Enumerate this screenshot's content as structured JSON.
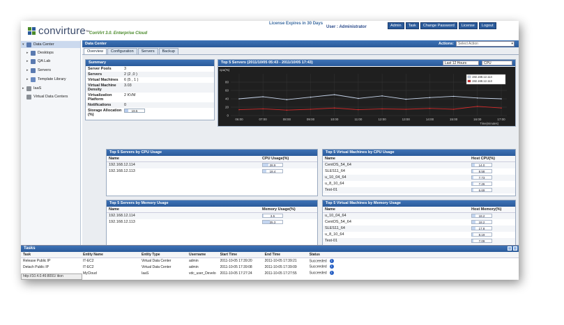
{
  "brand": {
    "name": "convirture",
    "tm": "TM",
    "edition": "ConVirt 3.0. Enterprise Cloud"
  },
  "header": {
    "license_text": "License Expires in 30 Days",
    "user_text": "User : Administrator",
    "nav": [
      "Admin",
      "Task",
      "Change Password",
      "License",
      "Logout"
    ]
  },
  "sidebar": {
    "items": [
      {
        "label": "Data Center",
        "icon": "datacenter-icon",
        "toggle": "▾",
        "selected": true
      },
      {
        "label": "Desktops",
        "icon": "server-pool-icon",
        "toggle": "▸"
      },
      {
        "label": "QA Lab",
        "icon": "server-pool-icon",
        "toggle": "▸"
      },
      {
        "label": "Servers",
        "icon": "server-pool-icon",
        "toggle": "▸"
      },
      {
        "label": "Template Library",
        "icon": "template-library-icon",
        "toggle": "▸"
      },
      {
        "label": "IaaS",
        "icon": "iaas-icon",
        "toggle": "▸"
      },
      {
        "label": "Virtual Data Centers",
        "icon": "vdc-icon",
        "toggle": ""
      }
    ]
  },
  "main": {
    "title": "Data Center",
    "actions_label": "Actions:",
    "actions_select": "Select Action",
    "tabs": [
      "Overview",
      "Configuration",
      "Servers",
      "Backup"
    ]
  },
  "summary": {
    "title": "Summary",
    "rows": [
      {
        "k": "Server Pools",
        "v": "3"
      },
      {
        "k": "Servers",
        "v": "2 (2 ,0 )"
      },
      {
        "k": "Virtual Machines",
        "v": "6 (5 , 1 )"
      },
      {
        "k": "Virtual Machine Density",
        "v": "3.03"
      },
      {
        "k": "Virtualization Platform",
        "v": "2 KVM"
      },
      {
        "k": "Notifications",
        "v": "0"
      },
      {
        "k": "Storage Allocation (%)",
        "v": "19.5"
      }
    ],
    "storage_pct": 19.5
  },
  "top_servers_chart": {
    "title": "Top 5 Servers (2011/10/05 05:43 - 2011/10/05 17:43)",
    "period": "Last 12 Hours",
    "metric": "CPU",
    "colors": {
      "s1": "#c8d6ec",
      "s2": "#d62a2a"
    }
  },
  "chart_data": {
    "type": "line",
    "title": "Top 5 Servers (2011/10/05 05:43 - 2011/10/05 17:43)",
    "ylabel": "cpu(%)",
    "xlabel": "Time(minutes)",
    "x": [
      "06:00",
      "07:00",
      "08:00",
      "09:00",
      "10:00",
      "11:00",
      "12:00",
      "13:00",
      "14:00",
      "15:00",
      "16:00",
      "17:00"
    ],
    "ylim": [
      0,
      100
    ],
    "yticks": [
      0,
      20,
      40,
      60,
      80
    ],
    "grid": true,
    "legend": "top-right",
    "series": [
      {
        "name": "192.168.12.114",
        "values": [
          40,
          45,
          38,
          44,
          50,
          41,
          47,
          39,
          43,
          46,
          42,
          40
        ]
      },
      {
        "name": "192.168.12.113",
        "values": [
          14,
          16,
          13,
          15,
          18,
          14,
          16,
          15,
          17,
          15,
          22,
          18
        ]
      }
    ]
  },
  "cpu_servers": {
    "title": "Top 5 Servers by CPU Usage",
    "columns": [
      "Name",
      "CPU Usage(%)"
    ],
    "rows": [
      {
        "name": "192.168.12.114",
        "val": "28.9",
        "pct": 28.9
      },
      {
        "name": "192.168.12.113",
        "val": "18.4",
        "pct": 18.4
      }
    ]
  },
  "cpu_vms": {
    "title": "Top 5 Virtual Machines by CPU Usage",
    "columns": [
      "Name",
      "Host CPU(%)"
    ],
    "rows": [
      {
        "name": "CentOS_54_64",
        "val": "14.0",
        "pct": 14.0
      },
      {
        "name": "SLES11_64",
        "val": "8.58",
        "pct": 8.58
      },
      {
        "name": "u_10_04_64",
        "val": "7.73",
        "pct": 7.73
      },
      {
        "name": "u_8_10_64",
        "val": "7.26",
        "pct": 7.26
      },
      {
        "name": "Test-01",
        "val": "6.69",
        "pct": 6.69
      }
    ]
  },
  "mem_servers": {
    "title": "Top 5 Servers by Memory Usage",
    "columns": [
      "Name",
      "Memory Usage(%)"
    ],
    "rows": [
      {
        "name": "192.168.12.114",
        "val": "3.5",
        "pct": 3.5
      },
      {
        "name": "192.168.12.113",
        "val": "35.3",
        "pct": 35.3
      }
    ]
  },
  "mem_vms": {
    "title": "Top 5 Virtual Machines by Memory Usage",
    "columns": [
      "Name",
      "Host Memory(%)"
    ],
    "rows": [
      {
        "name": "u_10_04_64",
        "val": "18.2",
        "pct": 18.2
      },
      {
        "name": "CentOS_54_64",
        "val": "18.2",
        "pct": 18.2
      },
      {
        "name": "SLES11_64",
        "val": "17.8",
        "pct": 17.8
      },
      {
        "name": "u_8_10_64",
        "val": "8.19",
        "pct": 8.19
      },
      {
        "name": "Test-01",
        "val": "7.09",
        "pct": 7.09
      }
    ]
  },
  "tasks": {
    "title": "Tasks",
    "columns": [
      "Task",
      "Entity Name",
      "Entity Type",
      "Username",
      "Start Time",
      "End Time",
      "Status"
    ],
    "rows": [
      [
        "Release Public IP",
        "IT-EC2",
        "Virtual Data Center",
        "admin",
        "2011-10-05 17:39:20",
        "2011-10-05 17:39:21",
        "Succeeded"
      ],
      [
        "Detach Public IP",
        "IT-EC2",
        "Virtual Data Center",
        "admin",
        "2011-10-05 17:39:08",
        "2011-10-05 17:39:09",
        "Succeeded"
      ],
      [
        "",
        "MyCloud",
        "IaaS",
        "vdc_user_Develo",
        "2011-10-05 17:27:24",
        "2011-10-05 17:27:55",
        "Succeeded"
      ]
    ],
    "status_url": "http://10.4.0.46:8091/ ition"
  }
}
